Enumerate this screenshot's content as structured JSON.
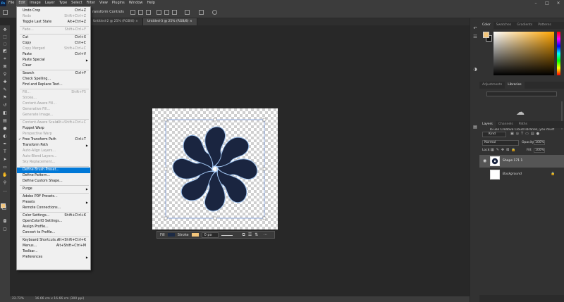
{
  "menubar": {
    "items": [
      "File",
      "Edit",
      "Image",
      "Layer",
      "Type",
      "Select",
      "Filter",
      "View",
      "Plugins",
      "Window",
      "Help"
    ],
    "active": "Edit"
  },
  "options_bar": {
    "label": "ransform Controls"
  },
  "tabs": [
    {
      "label": "Untitled-2 @ 25% (RGB/8) ×"
    },
    {
      "label": "Untitled-3 @ 25% (RGB/8) ×"
    }
  ],
  "edit_menu": {
    "items": [
      {
        "label": "Undo Crop",
        "shortcut": "Ctrl+Z"
      },
      {
        "label": "Redo",
        "shortcut": "Shift+Ctrl+Z",
        "disabled": true
      },
      {
        "label": "Toggle Last State",
        "shortcut": "Alt+Ctrl+Z"
      },
      {
        "sep": true
      },
      {
        "label": "Fade...",
        "shortcut": "Shift+Ctrl+F",
        "disabled": true
      },
      {
        "sep": true
      },
      {
        "label": "Cut",
        "shortcut": "Ctrl+X"
      },
      {
        "label": "Copy",
        "shortcut": "Ctrl+C"
      },
      {
        "label": "Copy Merged",
        "shortcut": "Shift+Ctrl+C",
        "disabled": true
      },
      {
        "label": "Paste",
        "shortcut": "Ctrl+V"
      },
      {
        "label": "Paste Special",
        "submenu": true
      },
      {
        "label": "Clear"
      },
      {
        "sep": true
      },
      {
        "label": "Search",
        "shortcut": "Ctrl+F"
      },
      {
        "label": "Check Spelling..."
      },
      {
        "label": "Find and Replace Text..."
      },
      {
        "sep": true
      },
      {
        "label": "Fill...",
        "shortcut": "Shift+F5",
        "disabled": true
      },
      {
        "label": "Stroke...",
        "disabled": true
      },
      {
        "label": "Content-Aware Fill...",
        "disabled": true
      },
      {
        "label": "Generative Fill...",
        "disabled": true
      },
      {
        "label": "Generate Image...",
        "disabled": true
      },
      {
        "sep": true
      },
      {
        "label": "Content-Aware Scale",
        "shortcut": "Alt+Shift+Ctrl+C",
        "disabled": true
      },
      {
        "label": "Puppet Warp"
      },
      {
        "label": "Perspective Warp",
        "disabled": true
      },
      {
        "label": "Free Transform Path",
        "shortcut": "Ctrl+T",
        "checked": true
      },
      {
        "label": "Transform Path",
        "submenu": true
      },
      {
        "label": "Auto-Align Layers...",
        "disabled": true
      },
      {
        "label": "Auto-Blend Layers...",
        "disabled": true
      },
      {
        "label": "Sky Replacement...",
        "disabled": true
      },
      {
        "sep": true
      },
      {
        "label": "Define Brush Preset...",
        "highlighted": true
      },
      {
        "label": "Define Pattern..."
      },
      {
        "label": "Define Custom Shape..."
      },
      {
        "sep": true
      },
      {
        "label": "Purge",
        "submenu": true
      },
      {
        "sep": true
      },
      {
        "label": "Adobe PDF Presets..."
      },
      {
        "label": "Presets",
        "submenu": true
      },
      {
        "label": "Remote Connections..."
      },
      {
        "sep": true
      },
      {
        "label": "Color Settings...",
        "shortcut": "Shift+Ctrl+K"
      },
      {
        "label": "OpenColorIO Settings..."
      },
      {
        "label": "Assign Profile..."
      },
      {
        "label": "Convert to Profile..."
      },
      {
        "sep": true
      },
      {
        "label": "Keyboard Shortcuts...",
        "shortcut": "Alt+Shift+Ctrl+K"
      },
      {
        "label": "Menus...",
        "shortcut": "Alt+Shift+Ctrl+M"
      },
      {
        "label": "Toolbar..."
      },
      {
        "label": "Preferences",
        "submenu": true
      }
    ]
  },
  "context_bar": {
    "fill_label": "Fill",
    "stroke_label": "Stroke",
    "stroke_width": "0 px",
    "fill_color": "#1c2a44",
    "stroke_color": "#f3c57a"
  },
  "status": {
    "zoom": "22.72%",
    "dimensions": "16.66 cm x 16.66 cm (300 ppi)"
  },
  "color_panel": {
    "tabs": [
      "Color",
      "Swatches",
      "Gradients",
      "Patterns"
    ],
    "foreground": "#f3c57a",
    "hue_color": "#ffa500"
  },
  "adjustments_panel": {
    "tabs": [
      "Adjustments",
      "Libraries"
    ],
    "message": "To use Creative Cloud libraries, you must"
  },
  "layers_panel": {
    "tabs": [
      "Layers",
      "Channels",
      "Paths"
    ],
    "filter_kind": "Kind",
    "blend_mode": "Normal",
    "opacity_label": "Opacity:",
    "opacity_value": "100%",
    "lock_label": "Lock:",
    "fill_label": "Fill:",
    "fill_value": "100%",
    "layers": [
      {
        "name": "Shape 171 1"
      },
      {
        "name": "Background"
      }
    ]
  },
  "artwork": {
    "petal_color": "#1a2540",
    "outline_color": "#9fc3ef"
  }
}
